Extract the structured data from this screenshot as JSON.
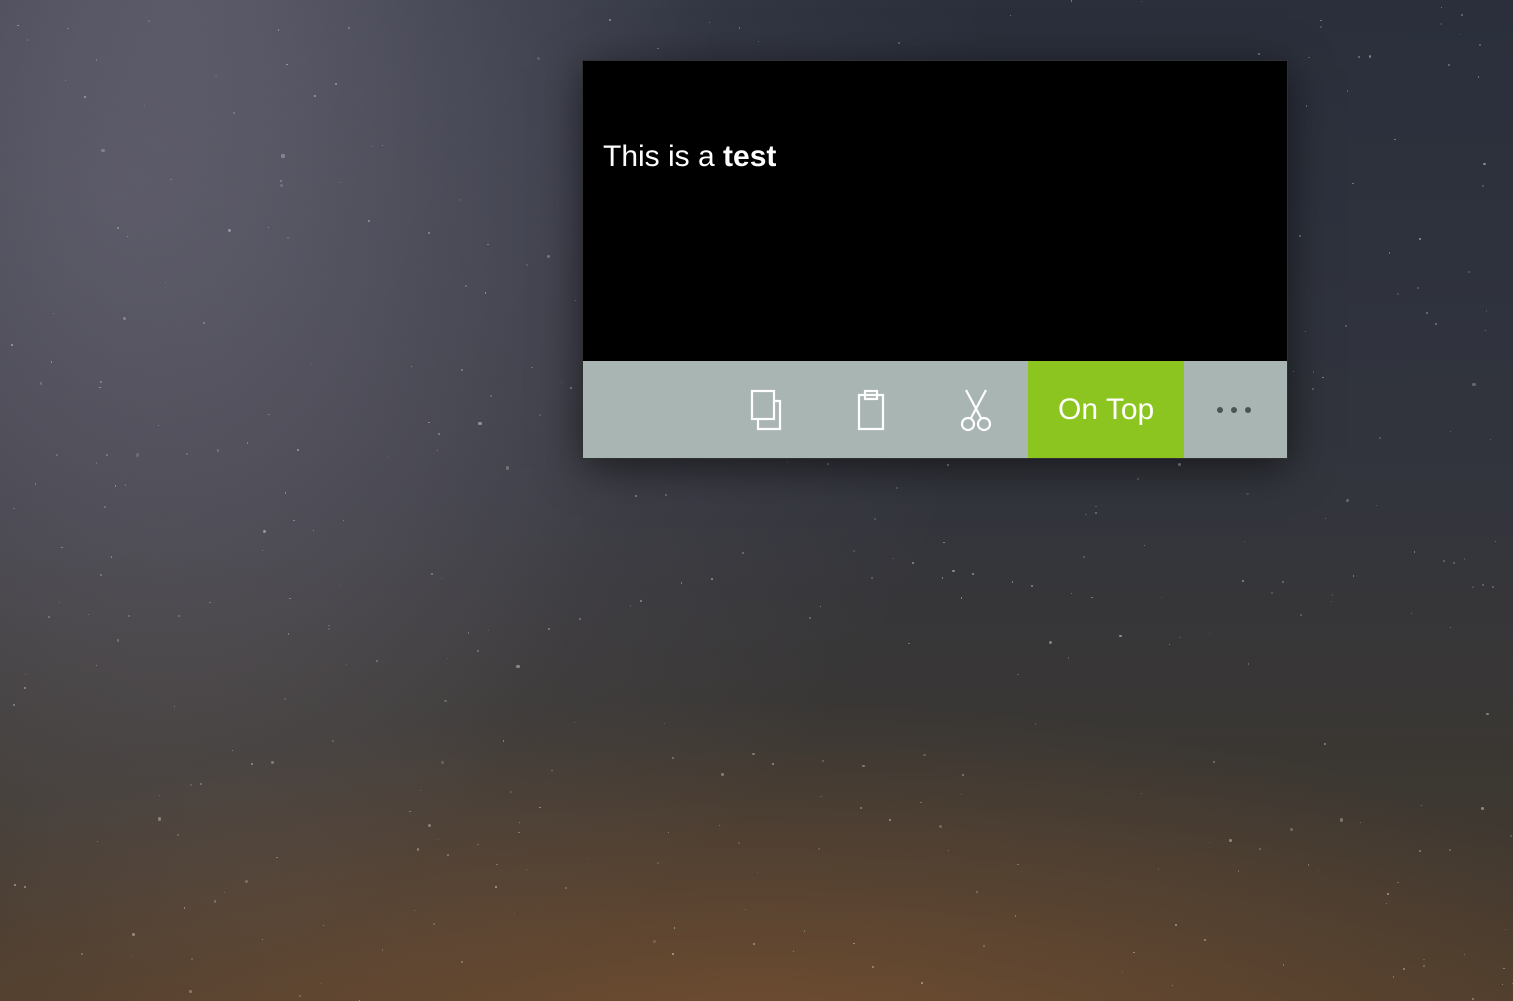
{
  "note": {
    "text_plain": "This is a ",
    "text_bold": "test"
  },
  "toolbar": {
    "copy_label": "Copy",
    "paste_label": "Paste",
    "cut_label": "Cut",
    "on_top_label": "On Top",
    "on_top_active": true,
    "more_label": "More"
  },
  "colors": {
    "accent": "#8cc520",
    "toolbar_bg": "#a9b5b2",
    "content_bg": "#000000",
    "content_fg": "#ffffff"
  }
}
